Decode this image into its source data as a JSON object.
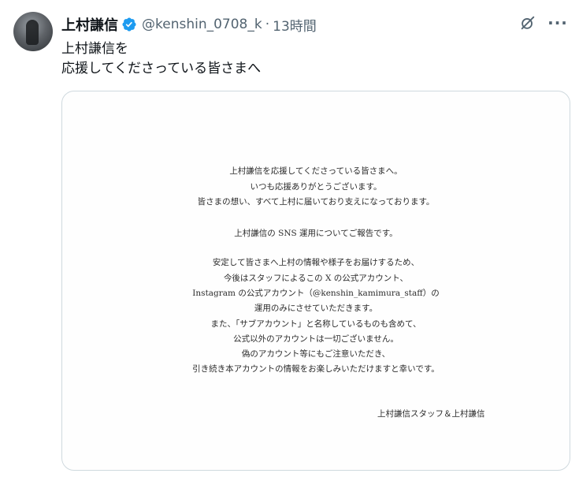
{
  "tweet": {
    "author_name": "上村謙信",
    "handle": "@kenshin_0708_k",
    "separator": "·",
    "time": "13時間",
    "text_line1": "上村謙信を",
    "text_line2": "応援してくださっている皆さまへ"
  },
  "icons": {
    "verified": "verified-badge-icon",
    "grok": "grok-icon",
    "more": "more-icon"
  },
  "colors": {
    "verified": "#1d9bf0",
    "text": "#0f1419",
    "secondary": "#536471",
    "border": "#cfd9de"
  },
  "more_label": "···",
  "notice": {
    "lines": [
      "上村謙信を応援してくださっている皆さまへ。",
      "いつも応援ありがとうございます。",
      "皆さまの想い、すべて上村に届いており支えになっております。",
      "上村謙信の SNS 運用についてご報告です。",
      "安定して皆さまへ上村の情報や様子をお届けするため、",
      "今後はスタッフによるこの X の公式アカウント、",
      "Instagram の公式アカウント（@kenshin_kamimura_staff）の",
      "運用のみにさせていただきます。",
      "また、「サブアカウント」と名称しているものも含めて、",
      "公式以外のアカウントは一切ございません。",
      "偽のアカウント等にもご注意いただき、",
      "引き続き本アカウントの情報をお楽しみいただけますと幸いです。"
    ],
    "signature": "上村謙信スタッフ＆上村謙信"
  }
}
